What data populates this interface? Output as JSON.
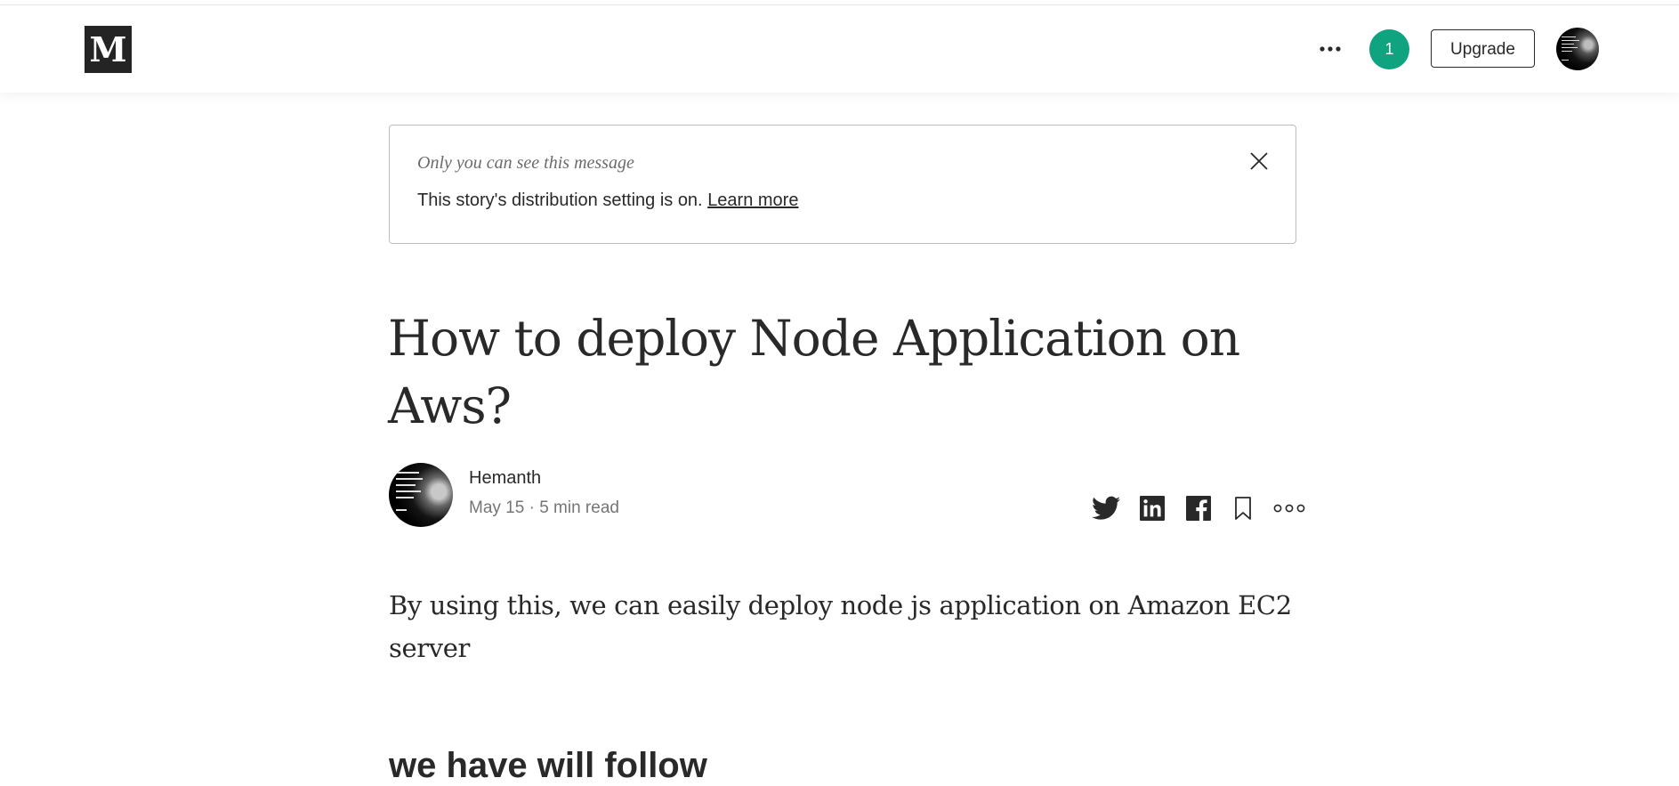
{
  "header": {
    "logo_letter": "M",
    "notification_count": "1",
    "upgrade_label": "Upgrade",
    "icons": [
      "more-horizontal-icon",
      "notification-badge",
      "avatar"
    ]
  },
  "banner": {
    "note": "Only you can see this message",
    "message": "This story's distribution setting is on.",
    "link": "Learn more"
  },
  "article": {
    "title_line1": "How to deploy Node Application on",
    "title_line2": "Aws?",
    "author": "Hemanth",
    "meta": "May 15 · 5 min read",
    "intro_line1": "By using this, we can easily deploy node js application on Amazon EC2",
    "intro_line2": "server",
    "next_heading": "we have will follow"
  },
  "share_icons": [
    "twitter-icon",
    "linkedin-icon",
    "facebook-icon",
    "bookmark-icon",
    "more-options-icon"
  ],
  "colors": {
    "accent": "#10a37f",
    "text": "#292929",
    "muted": "#757575",
    "logo_bg": "#242424"
  }
}
